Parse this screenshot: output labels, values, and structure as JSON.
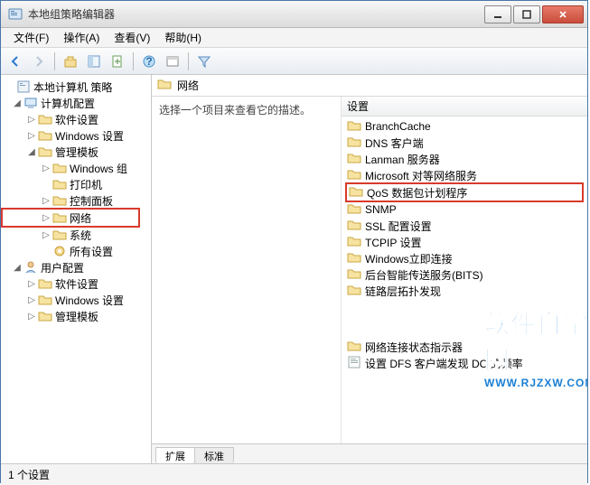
{
  "window": {
    "title": "本地组策略编辑器"
  },
  "menubar": {
    "file": "文件(F)",
    "action": "操作(A)",
    "view": "查看(V)",
    "help": "帮助(H)"
  },
  "tree": {
    "root": "本地计算机 策略",
    "computer_config": "计算机配置",
    "software_settings": "软件设置",
    "windows_settings": "Windows 设置",
    "admin_templates": "管理模板",
    "windows_components": "Windows 组",
    "printers": "打印机",
    "control_panel": "控制面板",
    "network": "网络",
    "system": "系统",
    "all_settings": "所有设置",
    "user_config": "用户配置",
    "user_software_settings": "软件设置",
    "user_windows_settings": "Windows 设置",
    "user_admin_templates": "管理模板"
  },
  "right": {
    "header_title": "网络",
    "description_prompt": "选择一个项目来查看它的描述。",
    "list_header": "设置",
    "tabs": {
      "extended": "扩展",
      "standard": "标准"
    },
    "items": [
      "BranchCache",
      "DNS 客户端",
      "Lanman 服务器",
      "Microsoft 对等网络服务",
      "QoS 数据包计划程序",
      "SNMP",
      "SSL 配置设置",
      "TCPIP 设置",
      "Windows立即连接",
      "后台智能传送服务(BITS)",
      "链路层拓扑发现",
      "网络连接状态指示器",
      "设置 DFS 客户端发现 DC 的频率"
    ]
  },
  "statusbar": {
    "text": "1 个设置"
  },
  "watermark": {
    "big": "软件自学网",
    "small": "WWW.RJZXW.COM"
  },
  "colors": {
    "highlight_red": "#d93a2b",
    "accent": "#1a7fd4"
  }
}
